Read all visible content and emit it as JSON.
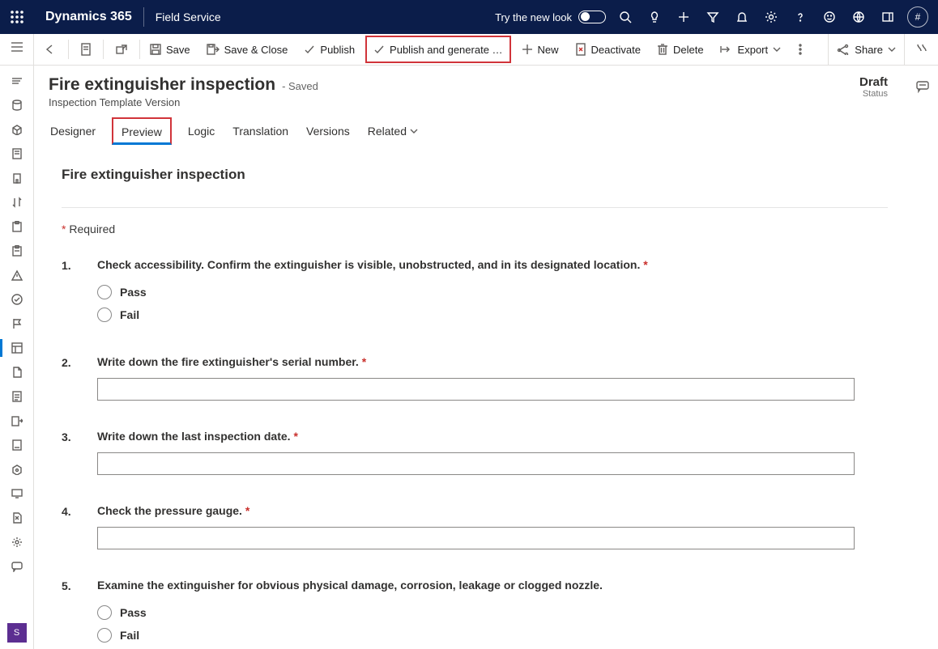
{
  "top": {
    "product": "Dynamics 365",
    "area": "Field Service",
    "try_look": "Try the new look",
    "avatar": "#"
  },
  "commands": {
    "save": "Save",
    "save_close": "Save & Close",
    "publish": "Publish",
    "publish_gen": "Publish and generate …",
    "new": "New",
    "deactivate": "Deactivate",
    "delete": "Delete",
    "export": "Export",
    "share": "Share"
  },
  "page": {
    "title": "Fire extinguisher inspection",
    "saved": "- Saved",
    "subtitle": "Inspection Template Version",
    "status_value": "Draft",
    "status_label": "Status"
  },
  "tabs": {
    "designer": "Designer",
    "preview": "Preview",
    "logic": "Logic",
    "translation": "Translation",
    "versions": "Versions",
    "related": "Related"
  },
  "preview": {
    "heading": "Fire extinguisher inspection",
    "required_note": "Required",
    "pass": "Pass",
    "fail": "Fail",
    "questions": [
      {
        "num": "1.",
        "text": "Check accessibility. Confirm the extinguisher is visible, unobstructed, and in its designated location.",
        "required": true,
        "type": "radio"
      },
      {
        "num": "2.",
        "text": "Write down the fire extinguisher's serial number.",
        "required": true,
        "type": "text"
      },
      {
        "num": "3.",
        "text": "Write down the last inspection date.",
        "required": true,
        "type": "text"
      },
      {
        "num": "4.",
        "text": "Check the pressure gauge.",
        "required": true,
        "type": "text"
      },
      {
        "num": "5.",
        "text": "Examine the extinguisher for obvious physical damage, corrosion, leakage or clogged nozzle.",
        "required": false,
        "type": "radio"
      }
    ]
  },
  "leftrail_bottom": "S"
}
